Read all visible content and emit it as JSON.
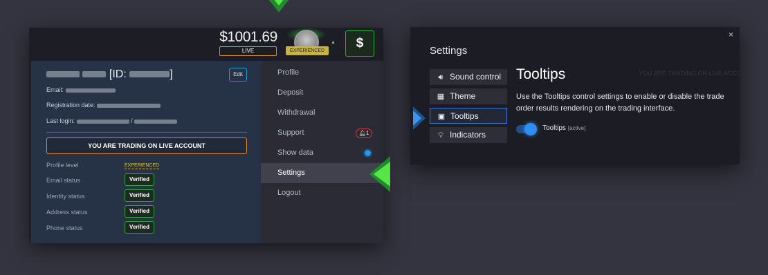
{
  "account": {
    "balance": "$1001.69",
    "mode_badge": "LIVE",
    "level_badge": "EXPERIENCED",
    "deposit_symbol": "$"
  },
  "profile": {
    "id_label": "[ID:",
    "id_close": "]",
    "edit_label": "Edit",
    "email_label": "Email:",
    "registration_label": "Registration date:",
    "last_login_label": "Last login:",
    "last_login_sep": "/",
    "live_banner": "YOU ARE TRADING ON LIVE ACCOUNT",
    "statuses": [
      {
        "label": "Profile level",
        "value": "EXPERIENCED"
      },
      {
        "label": "Email status",
        "value": "Verified"
      },
      {
        "label": "Identity status",
        "value": "Verified"
      },
      {
        "label": "Address status",
        "value": "Verified"
      },
      {
        "label": "Phone status",
        "value": "Verified"
      }
    ]
  },
  "menu": {
    "items": [
      {
        "label": "Profile"
      },
      {
        "label": "Deposit"
      },
      {
        "label": "Withdrawal"
      },
      {
        "label": "Support",
        "badge": "1"
      },
      {
        "label": "Show data"
      },
      {
        "label": "Settings"
      },
      {
        "label": "Logout"
      }
    ],
    "active": "Settings",
    "show_data_on": true
  },
  "settings": {
    "title": "Settings",
    "tabs": [
      {
        "label": "Sound control",
        "icon": "speaker-icon"
      },
      {
        "label": "Theme",
        "icon": "grid-icon"
      },
      {
        "label": "Tooltips",
        "icon": "comment-icon"
      },
      {
        "label": "Indicators",
        "icon": "lightbulb-icon"
      }
    ],
    "active_tab": "Tooltips",
    "heading": "Tooltips",
    "description": "Use the Tooltips control settings to enable or disable the trade order results rendering on the trading interface.",
    "toggle_label": "Tooltips",
    "toggle_state": "[active]",
    "background_banner": "YOU ARE TRADING ON LIVE ACCO",
    "close_glyph": "×"
  },
  "colors": {
    "page_bg": "#33343f",
    "live_orange": "#e08a1e",
    "experienced_gold": "#c9b43a",
    "verified_green": "#2ea63a",
    "accent_blue": "#2196f3",
    "pointer_green": "#39d12f",
    "pointer_blue": "#2b7fd8"
  }
}
